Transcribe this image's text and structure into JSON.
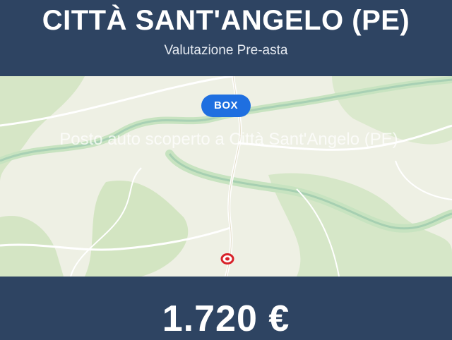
{
  "header": {
    "title": "CITTÀ SANT'ANGELO (PE)",
    "subtitle": "Valutazione Pre-asta"
  },
  "map": {
    "badge_label": "BOX",
    "overlay_text": "Posto auto scoperto a Città Sant'Angelo (PE)",
    "pin_icon": "location-marker-icon"
  },
  "footer": {
    "price": "1.720 €"
  },
  "colors": {
    "background": "#2e4462",
    "badge": "#1f6fe0",
    "pin": "#d8232a"
  }
}
